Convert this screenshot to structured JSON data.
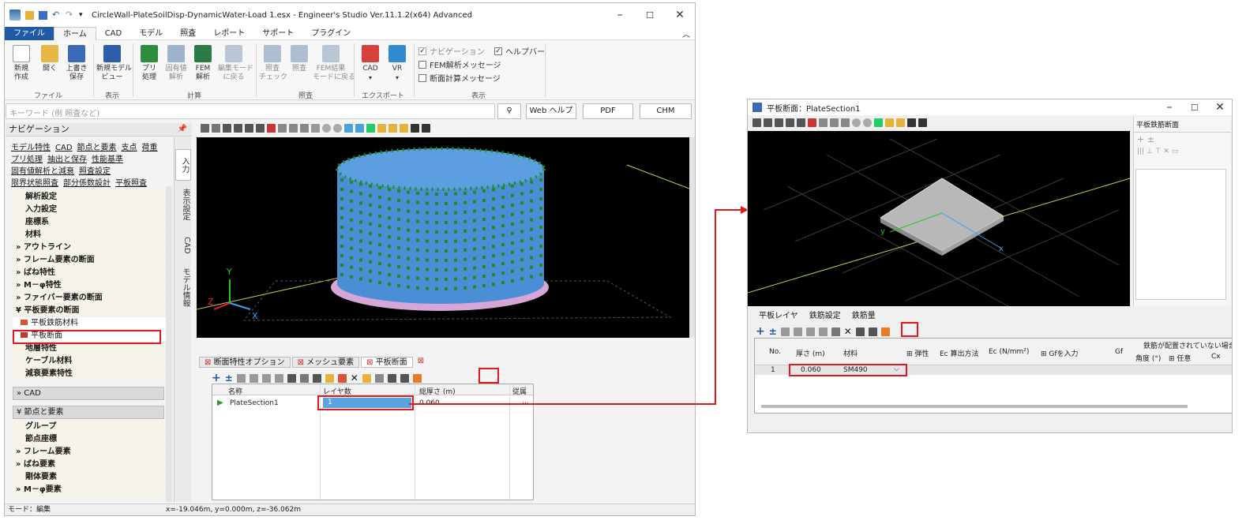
{
  "main_window": {
    "title": "CircleWall-PlateSoilDisp-DynamicWater-Load 1.esx - Engineer's Studio Ver.11.1.2(x64) Advanced",
    "menus": [
      "ファイル",
      "ホーム",
      "CAD",
      "モデル",
      "照査",
      "レポート",
      "サポート",
      "プラグイン"
    ],
    "ribbon": {
      "file_group": {
        "label": "ファイル",
        "buttons": [
          "新規\n作成",
          "開く",
          "上書き\n保存"
        ]
      },
      "display_group": {
        "label": "表示",
        "buttons": [
          "新規モデル\nビュー"
        ]
      },
      "calc_group": {
        "label": "計算",
        "buttons": [
          "プリ\n処理",
          "固有値\n解析",
          "FEM\n解析",
          "編集モード\nに戻る"
        ]
      },
      "check_group": {
        "label": "照査",
        "buttons": [
          "照査\nチェック",
          "照査",
          "FEM結果\nモードに戻る"
        ]
      },
      "export_group": {
        "label": "エクスポート",
        "buttons": [
          "CAD",
          "VR"
        ]
      },
      "view_group": {
        "label": "表示",
        "checks": [
          {
            "label": "ナビゲーション",
            "checked": true
          },
          {
            "label": "FEM解析メッセージ",
            "checked": false
          },
          {
            "label": "断面計算メッセージ",
            "checked": false
          },
          {
            "label": "ヘルプバー",
            "checked": true
          }
        ]
      }
    },
    "search_placeholder": "キーワード (例 照査など)",
    "help_buttons": [
      "Web ヘルプ",
      "PDF",
      "CHM"
    ],
    "nav": {
      "title": "ナビゲーション",
      "links": [
        [
          "モデル特性",
          "CAD",
          "節点と要素",
          "支点",
          "荷重"
        ],
        [
          "プリ処理",
          "抽出と保存",
          "性能基準"
        ],
        [
          "固有値解析と減衰",
          "照査設定"
        ],
        [
          "限界状態照査",
          "部分係数設計",
          "平板照査"
        ]
      ],
      "tree": [
        {
          "label": "解析設定",
          "type": "leaf"
        },
        {
          "label": "入力設定",
          "type": "leaf"
        },
        {
          "label": "座標系",
          "type": "leaf"
        },
        {
          "label": "材料",
          "type": "leaf"
        },
        {
          "label": "アウトライン",
          "type": "exp"
        },
        {
          "label": "フレーム要素の断面",
          "type": "exp"
        },
        {
          "label": "ばね特性",
          "type": "exp"
        },
        {
          "label": "M－φ特性",
          "type": "exp"
        },
        {
          "label": "ファイバー要素の断面",
          "type": "exp"
        },
        {
          "label": "平板要素の断面",
          "type": "open"
        },
        {
          "label": "平板鉄筋材料",
          "type": "child"
        },
        {
          "label": "平板断面",
          "type": "child"
        },
        {
          "label": "地層特性",
          "type": "leaf"
        },
        {
          "label": "ケーブル材料",
          "type": "leaf"
        },
        {
          "label": "減衰要素特性",
          "type": "leaf"
        }
      ],
      "cad_bar": "CAD",
      "nodes_bar": "節点と要素",
      "tree2": [
        {
          "label": "グループ",
          "type": "leaf"
        },
        {
          "label": "節点座標",
          "type": "leaf"
        },
        {
          "label": "フレーム要素",
          "type": "exp"
        },
        {
          "label": "ばね要素",
          "type": "exp"
        },
        {
          "label": "剛体要素",
          "type": "leaf"
        },
        {
          "label": "M－φ要素",
          "type": "exp"
        }
      ],
      "side_tabs": [
        "入力",
        "表示設定",
        "CAD",
        "モデル情報"
      ]
    },
    "bottom_tabs": [
      "断面特性オプション",
      "メッシュ要素",
      "平板断面"
    ],
    "grid": {
      "headers": [
        "名称",
        "レイヤ数",
        "総厚さ (m)",
        "従属"
      ],
      "row": {
        "name": "PlateSection1",
        "layers": "1",
        "thickness": "0.060",
        "dep": "..."
      }
    },
    "status_mode": "モード：編集",
    "status_coords": "x=-19.046m, y=0.000m, z=-36.062m",
    "axes": {
      "x": "X",
      "y": "Y",
      "z": "Z"
    }
  },
  "sub_window": {
    "title": "平板断面：PlateSection1",
    "right_panel_tab": "平板鉄筋断面",
    "tabs": [
      "平板レイヤ",
      "鉄筋設定",
      "鉄筋量"
    ],
    "headers": [
      "No.",
      "厚さ (m)",
      "材料",
      "弾性",
      "Ec 算出方法",
      "Ec (N/mm²)",
      "Gfを入力",
      "Gf",
      "鉄筋が配置されていない場合",
      "角度 (°)",
      "任意",
      "Cx"
    ],
    "row": {
      "no": "1",
      "thickness": "0.060",
      "material": "SM490"
    },
    "axes": {
      "x": "x",
      "y": "y"
    }
  },
  "colors": {
    "accent": "#1f5aa6",
    "highlight": "#e0191e",
    "cylinder": "#4a8fd6",
    "nodes": "#1e8c1e",
    "support": "#d9a9d9"
  }
}
